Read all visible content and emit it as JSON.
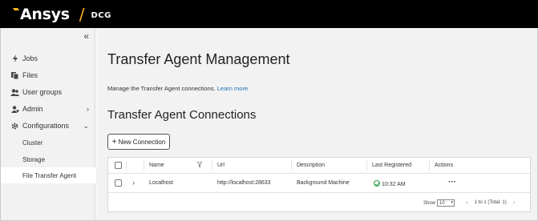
{
  "header": {
    "brand": "Ansys",
    "product": "DCG"
  },
  "sidebar": {
    "collapse_icon": "«",
    "items": [
      {
        "label": "Jobs",
        "icon": "lightning-icon"
      },
      {
        "label": "Files",
        "icon": "files-icon"
      },
      {
        "label": "User groups",
        "icon": "users-icon"
      },
      {
        "label": "Admin",
        "icon": "admin-icon"
      },
      {
        "label": "Configurations",
        "icon": "gear-icon"
      }
    ],
    "sub_items": [
      {
        "label": "Cluster"
      },
      {
        "label": "Storage"
      },
      {
        "label": "File Transfer Agent",
        "active": true
      }
    ]
  },
  "main": {
    "title": "Transfer Agent Management",
    "description": "Manage the Transfer Agent connections.",
    "learn_more": "Learn more",
    "section_title": "Transfer Agent Connections",
    "new_button": "New Connection",
    "table": {
      "columns": [
        "Name",
        "Url",
        "Description",
        "Last Registered",
        "Actions"
      ],
      "rows": [
        {
          "name": "Localhost",
          "url": "http://localhost:28633",
          "description": "Background Machine",
          "last_registered": "10:32 AM"
        }
      ],
      "footer": {
        "show_label": "Show",
        "page_size": "10",
        "range": "1 to 1 (Total: 1)"
      }
    }
  },
  "colors": {
    "accent": "#ffb71b",
    "link": "#1a6fb5",
    "success": "#2e9b4a"
  }
}
